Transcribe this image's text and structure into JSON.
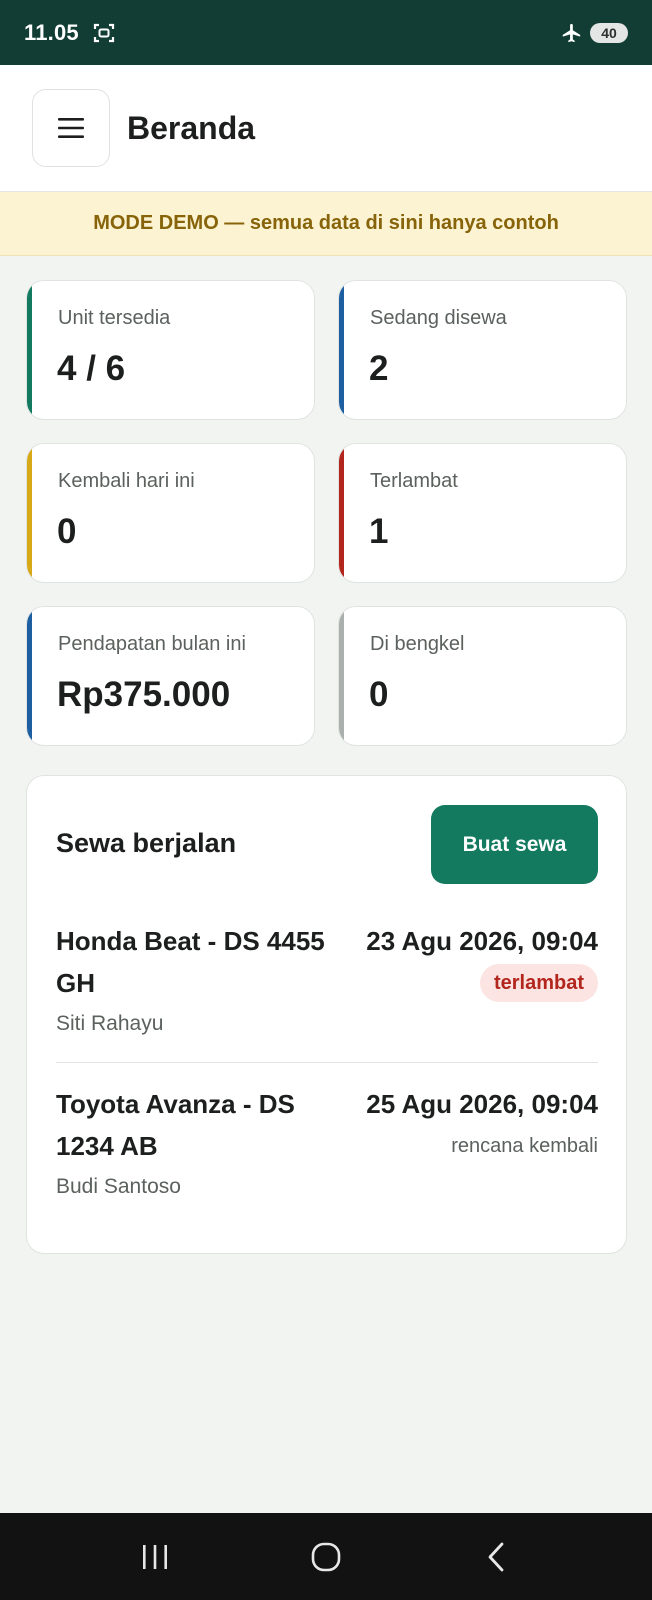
{
  "status_bar": {
    "time": "11.05",
    "battery": "40",
    "icons": [
      "screenshot-icon",
      "airplane-icon"
    ]
  },
  "header": {
    "title": "Beranda",
    "menu_icon": "hamburger-menu-icon"
  },
  "banner": {
    "text": "MODE DEMO — semua data di sini hanya contoh"
  },
  "stats": [
    {
      "label": "Unit tersedia",
      "value": "4 / 6",
      "accent": "#137a60"
    },
    {
      "label": "Sedang disewa",
      "value": "2",
      "accent": "#1d5fa0"
    },
    {
      "label": "Kembali hari ini",
      "value": "0",
      "accent": "#d8a917"
    },
    {
      "label": "Terlambat",
      "value": "1",
      "accent": "#b3261e"
    },
    {
      "label": "Pendapatan bulan ini",
      "value": "Rp375.000",
      "accent": "#1d5fa0"
    },
    {
      "label": "Di bengkel",
      "value": "0",
      "accent": "#a9b0ad"
    }
  ],
  "rentals": {
    "title": "Sewa berjalan",
    "create_button": "Buat sewa",
    "items": [
      {
        "vehicle": "Honda Beat - DS 4455 GH",
        "customer": "Siti Rahayu",
        "date": "23 Agu 2026, 09:04",
        "badge": "terlambat"
      },
      {
        "vehicle": "Toyota Avanza - DS 1234 AB",
        "customer": "Budi Santoso",
        "date": "25 Agu 2026, 09:04",
        "note": "rencana kembali"
      }
    ]
  },
  "nav_bar": {
    "icons": [
      "recent-apps-icon",
      "home-icon",
      "back-icon"
    ]
  },
  "colors": {
    "primary": "#137a60",
    "status_bar": "#123d34",
    "danger": "#b3261e",
    "banner_bg": "#fcf3d2",
    "banner_text": "#87640a"
  }
}
